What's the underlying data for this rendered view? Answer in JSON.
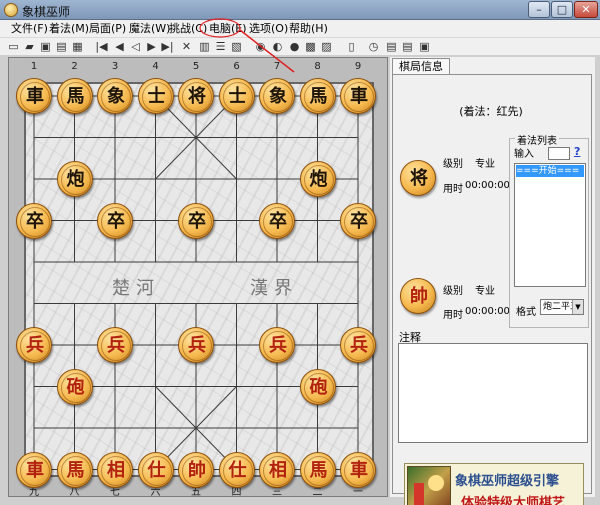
{
  "window": {
    "title": "象棋巫师"
  },
  "menu": [
    "文件(F)",
    "着法(M)",
    "局面(P)",
    "魔法(W)",
    "挑战(C)",
    "电脑(E)",
    "选项(O)",
    "帮助(H)"
  ],
  "toolbar": {
    "icons": [
      "new-game-icon",
      "open-file-icon",
      "save-icon",
      "print-icon",
      "export-icon",
      "first-move-icon",
      "prev-move-icon",
      "back-icon",
      "forward-icon",
      "last-move-icon",
      "delete-icon",
      "book-icon",
      "move-list-icon",
      "chart-icon",
      "search-icon",
      "hint-icon",
      "analyze-icon",
      "import-icon",
      "settings-icon",
      "timer-icon",
      "level-icon",
      "board-style-icon",
      "screen-icon",
      "exit-icon"
    ]
  },
  "board": {
    "top_coords": [
      "1",
      "2",
      "3",
      "4",
      "5",
      "6",
      "7",
      "8",
      "9"
    ],
    "bottom_coords": [
      "九",
      "八",
      "七",
      "六",
      "五",
      "四",
      "三",
      "二",
      "一"
    ],
    "river_left": "楚河",
    "river_right": "漢界",
    "pieces": [
      {
        "c": "車",
        "side": "black",
        "col": 0,
        "row": 0
      },
      {
        "c": "馬",
        "side": "black",
        "col": 1,
        "row": 0
      },
      {
        "c": "象",
        "side": "black",
        "col": 2,
        "row": 0
      },
      {
        "c": "士",
        "side": "black",
        "col": 3,
        "row": 0
      },
      {
        "c": "将",
        "side": "black",
        "col": 4,
        "row": 0
      },
      {
        "c": "士",
        "side": "black",
        "col": 5,
        "row": 0
      },
      {
        "c": "象",
        "side": "black",
        "col": 6,
        "row": 0
      },
      {
        "c": "馬",
        "side": "black",
        "col": 7,
        "row": 0
      },
      {
        "c": "車",
        "side": "black",
        "col": 8,
        "row": 0
      },
      {
        "c": "炮",
        "side": "black",
        "col": 1,
        "row": 2
      },
      {
        "c": "炮",
        "side": "black",
        "col": 7,
        "row": 2
      },
      {
        "c": "卒",
        "side": "black",
        "col": 0,
        "row": 3
      },
      {
        "c": "卒",
        "side": "black",
        "col": 2,
        "row": 3
      },
      {
        "c": "卒",
        "side": "black",
        "col": 4,
        "row": 3
      },
      {
        "c": "卒",
        "side": "black",
        "col": 6,
        "row": 3
      },
      {
        "c": "卒",
        "side": "black",
        "col": 8,
        "row": 3
      },
      {
        "c": "兵",
        "side": "red",
        "col": 0,
        "row": 6
      },
      {
        "c": "兵",
        "side": "red",
        "col": 2,
        "row": 6
      },
      {
        "c": "兵",
        "side": "red",
        "col": 4,
        "row": 6
      },
      {
        "c": "兵",
        "side": "red",
        "col": 6,
        "row": 6
      },
      {
        "c": "兵",
        "side": "red",
        "col": 8,
        "row": 6
      },
      {
        "c": "砲",
        "side": "red",
        "col": 1,
        "row": 7
      },
      {
        "c": "砲",
        "side": "red",
        "col": 7,
        "row": 7
      },
      {
        "c": "車",
        "side": "red",
        "col": 0,
        "row": 9
      },
      {
        "c": "馬",
        "side": "red",
        "col": 1,
        "row": 9
      },
      {
        "c": "相",
        "side": "red",
        "col": 2,
        "row": 9
      },
      {
        "c": "仕",
        "side": "red",
        "col": 3,
        "row": 9
      },
      {
        "c": "帥",
        "side": "red",
        "col": 4,
        "row": 9
      },
      {
        "c": "仕",
        "side": "red",
        "col": 5,
        "row": 9
      },
      {
        "c": "相",
        "side": "red",
        "col": 6,
        "row": 9
      },
      {
        "c": "馬",
        "side": "red",
        "col": 7,
        "row": 9
      },
      {
        "c": "車",
        "side": "red",
        "col": 8,
        "row": 9
      }
    ]
  },
  "panel": {
    "tab": "棋局信息",
    "move_side": "(着法：红先)",
    "black_player": {
      "glyph": "将",
      "level_label": "级别",
      "level_value": "专业",
      "time_label": "用时",
      "time_value": "00:00:00"
    },
    "red_player": {
      "glyph": "帥",
      "level_label": "级别",
      "level_value": "专业",
      "time_label": "用时",
      "time_value": "00:00:00"
    },
    "move_list": {
      "legend": "着法列表",
      "input_label": "输入",
      "help": "?",
      "items": [
        "===开始==="
      ],
      "format_label": "格式",
      "format_value": "炮二平五"
    },
    "notes_label": "注释",
    "banner": {
      "line1": "象棋巫师超级引擎",
      "line2": "体验特级大师棋艺"
    }
  },
  "colors": {
    "red_piece_text": "#b3210f",
    "black_piece_text": "#1e1408",
    "annotation": "#e02020"
  }
}
